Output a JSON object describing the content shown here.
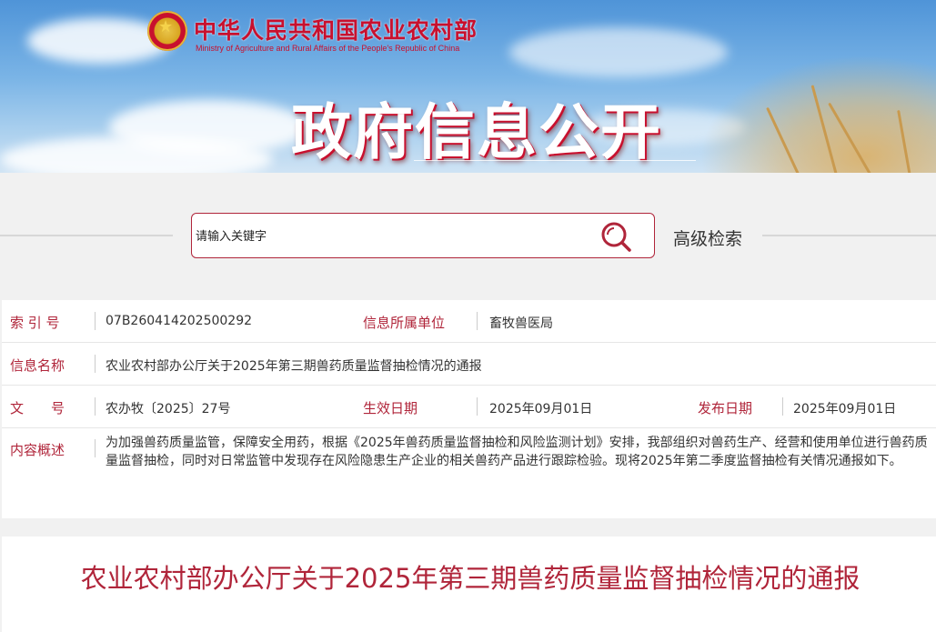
{
  "header": {
    "ministry_cn": "中华人民共和国农业农村部",
    "ministry_en": "Ministry of Agriculture and Rural Affairs of the People's Republic of China",
    "section_title": "政府信息公开"
  },
  "search": {
    "placeholder": "请输入关键字",
    "advanced_label": "高级检索"
  },
  "meta": {
    "index_label": "索 引 号",
    "index_value": "07B260414202500292",
    "unit_label": "信息所属单位",
    "unit_value": "畜牧兽医局",
    "name_label": "信息名称",
    "name_value": "农业农村部办公厅关于2025年第三期兽药质量监督抽检情况的通报",
    "doc_label": "文　　号",
    "doc_value": "农办牧〔2025〕27号",
    "effective_label": "生效日期",
    "effective_value": "2025年09月01日",
    "publish_label": "发布日期",
    "publish_value": "2025年09月01日",
    "summary_label": "内容概述",
    "summary_value": "为加强兽药质量监管，保障安全用药，根据《2025年兽药质量监督抽检和风险监测计划》安排，我部组织对兽药生产、经营和使用单位进行兽药质量监督抽检，同时对日常监管中发现存在风险隐患生产企业的相关兽药产品进行跟踪检验。现将2025年第二季度监督抽检有关情况通报如下。"
  },
  "article": {
    "title": "农业农村部办公厅关于2025年第三期兽药质量监督抽检情况的通报"
  },
  "colors": {
    "accent": "#b0253a",
    "banner_sky": "#6aa8e0"
  }
}
